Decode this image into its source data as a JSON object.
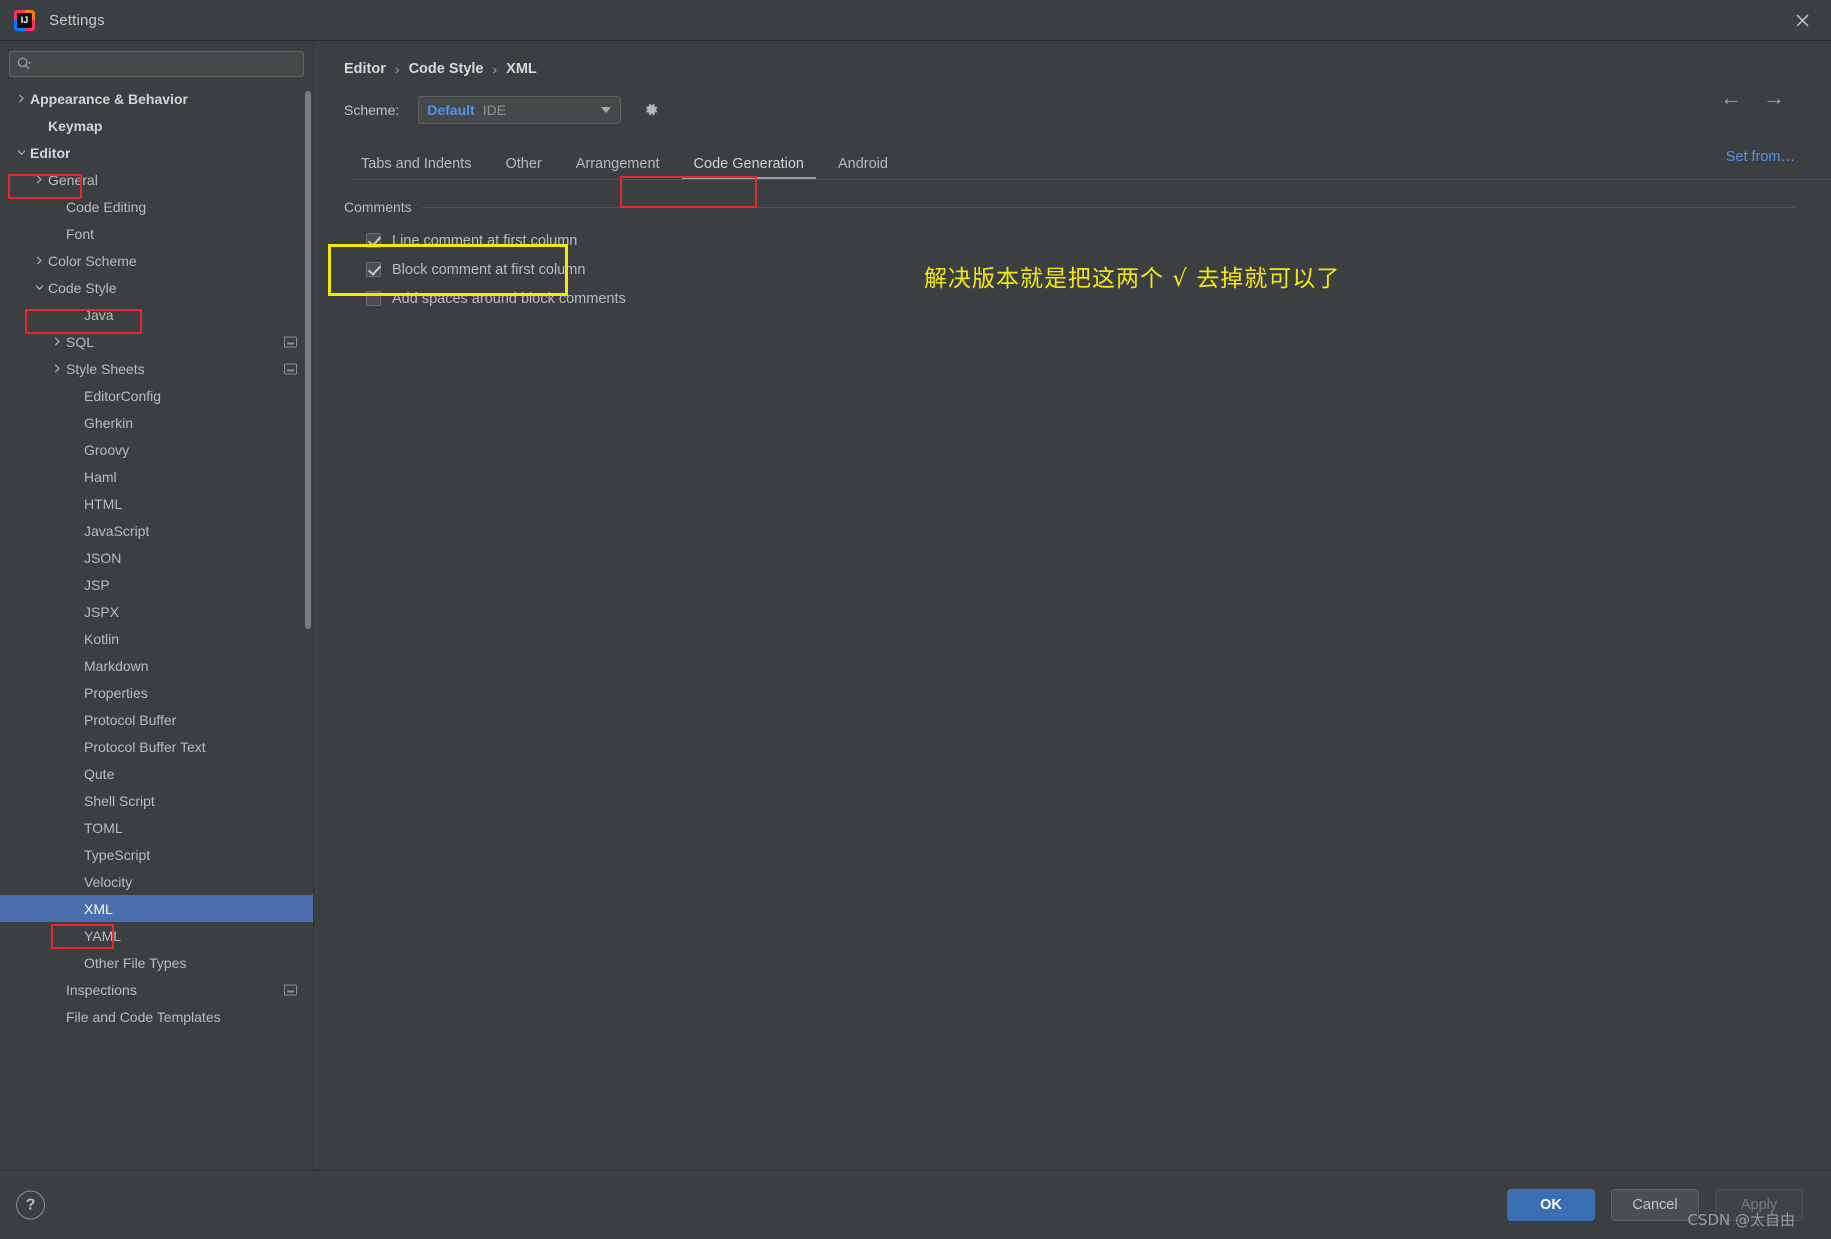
{
  "window": {
    "title": "Settings",
    "logo_text": "IJ",
    "close_icon": "close-icon"
  },
  "search": {
    "value": "",
    "placeholder": "",
    "icon": "search-icon"
  },
  "sidebar": {
    "items": [
      {
        "label": "Appearance & Behavior",
        "indent": 0,
        "twisty": "collapsed",
        "bold": true,
        "selected": false,
        "extra_icon": false
      },
      {
        "label": "Keymap",
        "indent": 1,
        "twisty": "none",
        "bold": true,
        "selected": false,
        "extra_icon": false
      },
      {
        "label": "Editor",
        "indent": 0,
        "twisty": "expanded",
        "bold": true,
        "selected": false,
        "extra_icon": false
      },
      {
        "label": "General",
        "indent": 1,
        "twisty": "collapsed",
        "bold": false,
        "selected": false,
        "extra_icon": false
      },
      {
        "label": "Code Editing",
        "indent": 2,
        "twisty": "none",
        "bold": false,
        "selected": false,
        "extra_icon": false
      },
      {
        "label": "Font",
        "indent": 2,
        "twisty": "none",
        "bold": false,
        "selected": false,
        "extra_icon": false
      },
      {
        "label": "Color Scheme",
        "indent": 1,
        "twisty": "collapsed",
        "bold": false,
        "selected": false,
        "extra_icon": false
      },
      {
        "label": "Code Style",
        "indent": 1,
        "twisty": "expanded",
        "bold": false,
        "selected": false,
        "extra_icon": false
      },
      {
        "label": "Java",
        "indent": 3,
        "twisty": "none",
        "bold": false,
        "selected": false,
        "extra_icon": false
      },
      {
        "label": "SQL",
        "indent": 2,
        "twisty": "collapsed",
        "bold": false,
        "selected": false,
        "extra_icon": true
      },
      {
        "label": "Style Sheets",
        "indent": 2,
        "twisty": "collapsed",
        "bold": false,
        "selected": false,
        "extra_icon": true
      },
      {
        "label": "EditorConfig",
        "indent": 3,
        "twisty": "none",
        "bold": false,
        "selected": false,
        "extra_icon": false
      },
      {
        "label": "Gherkin",
        "indent": 3,
        "twisty": "none",
        "bold": false,
        "selected": false,
        "extra_icon": false
      },
      {
        "label": "Groovy",
        "indent": 3,
        "twisty": "none",
        "bold": false,
        "selected": false,
        "extra_icon": false
      },
      {
        "label": "Haml",
        "indent": 3,
        "twisty": "none",
        "bold": false,
        "selected": false,
        "extra_icon": false
      },
      {
        "label": "HTML",
        "indent": 3,
        "twisty": "none",
        "bold": false,
        "selected": false,
        "extra_icon": false
      },
      {
        "label": "JavaScript",
        "indent": 3,
        "twisty": "none",
        "bold": false,
        "selected": false,
        "extra_icon": false
      },
      {
        "label": "JSON",
        "indent": 3,
        "twisty": "none",
        "bold": false,
        "selected": false,
        "extra_icon": false
      },
      {
        "label": "JSP",
        "indent": 3,
        "twisty": "none",
        "bold": false,
        "selected": false,
        "extra_icon": false
      },
      {
        "label": "JSPX",
        "indent": 3,
        "twisty": "none",
        "bold": false,
        "selected": false,
        "extra_icon": false
      },
      {
        "label": "Kotlin",
        "indent": 3,
        "twisty": "none",
        "bold": false,
        "selected": false,
        "extra_icon": false
      },
      {
        "label": "Markdown",
        "indent": 3,
        "twisty": "none",
        "bold": false,
        "selected": false,
        "extra_icon": false
      },
      {
        "label": "Properties",
        "indent": 3,
        "twisty": "none",
        "bold": false,
        "selected": false,
        "extra_icon": false
      },
      {
        "label": "Protocol Buffer",
        "indent": 3,
        "twisty": "none",
        "bold": false,
        "selected": false,
        "extra_icon": false
      },
      {
        "label": "Protocol Buffer Text",
        "indent": 3,
        "twisty": "none",
        "bold": false,
        "selected": false,
        "extra_icon": false
      },
      {
        "label": "Qute",
        "indent": 3,
        "twisty": "none",
        "bold": false,
        "selected": false,
        "extra_icon": false
      },
      {
        "label": "Shell Script",
        "indent": 3,
        "twisty": "none",
        "bold": false,
        "selected": false,
        "extra_icon": false
      },
      {
        "label": "TOML",
        "indent": 3,
        "twisty": "none",
        "bold": false,
        "selected": false,
        "extra_icon": false
      },
      {
        "label": "TypeScript",
        "indent": 3,
        "twisty": "none",
        "bold": false,
        "selected": false,
        "extra_icon": false
      },
      {
        "label": "Velocity",
        "indent": 3,
        "twisty": "none",
        "bold": false,
        "selected": false,
        "extra_icon": false
      },
      {
        "label": "XML",
        "indent": 3,
        "twisty": "none",
        "bold": false,
        "selected": true,
        "extra_icon": false
      },
      {
        "label": "YAML",
        "indent": 3,
        "twisty": "none",
        "bold": false,
        "selected": false,
        "extra_icon": false
      },
      {
        "label": "Other File Types",
        "indent": 3,
        "twisty": "none",
        "bold": false,
        "selected": false,
        "extra_icon": false
      },
      {
        "label": "Inspections",
        "indent": 2,
        "twisty": "none",
        "bold": false,
        "selected": false,
        "extra_icon": true
      },
      {
        "label": "File and Code Templates",
        "indent": 2,
        "twisty": "none",
        "bold": false,
        "selected": false,
        "extra_icon": false
      }
    ]
  },
  "main": {
    "breadcrumb": [
      "Editor",
      "Code Style",
      "XML"
    ],
    "breadcrumb_separator": "›",
    "nav_back_icon": "arrow-left-icon",
    "nav_forward_icon": "arrow-right-icon",
    "scheme_label": "Scheme:",
    "scheme_value": "Default",
    "scheme_kind": "IDE",
    "scheme_gear_icon": "gear-icon",
    "set_from_label": "Set from…",
    "tabs": [
      {
        "label": "Tabs and Indents",
        "active": false
      },
      {
        "label": "Other",
        "active": false
      },
      {
        "label": "Arrangement",
        "active": false
      },
      {
        "label": "Code Generation",
        "active": true
      },
      {
        "label": "Android",
        "active": false
      }
    ],
    "group_title": "Comments",
    "checkboxes": [
      {
        "label": "Line comment at first column",
        "checked": true
      },
      {
        "label": "Block comment at first column",
        "checked": true
      },
      {
        "label": "Add spaces around block comments",
        "checked": false
      }
    ],
    "annotation": "解决版本就是把这两个 √ 去掉就可以了"
  },
  "footer": {
    "help_icon": "question-mark-icon",
    "ok_label": "OK",
    "cancel_label": "Cancel",
    "apply_label": "Apply",
    "watermark": "CSDN @太自由"
  },
  "colors": {
    "accent_blue": "#5394ec",
    "selection_blue": "#4b6eaf",
    "highlight_red": "#e8262b",
    "highlight_yellow": "#f5e80c",
    "primary_button": "#3c6eb4"
  }
}
